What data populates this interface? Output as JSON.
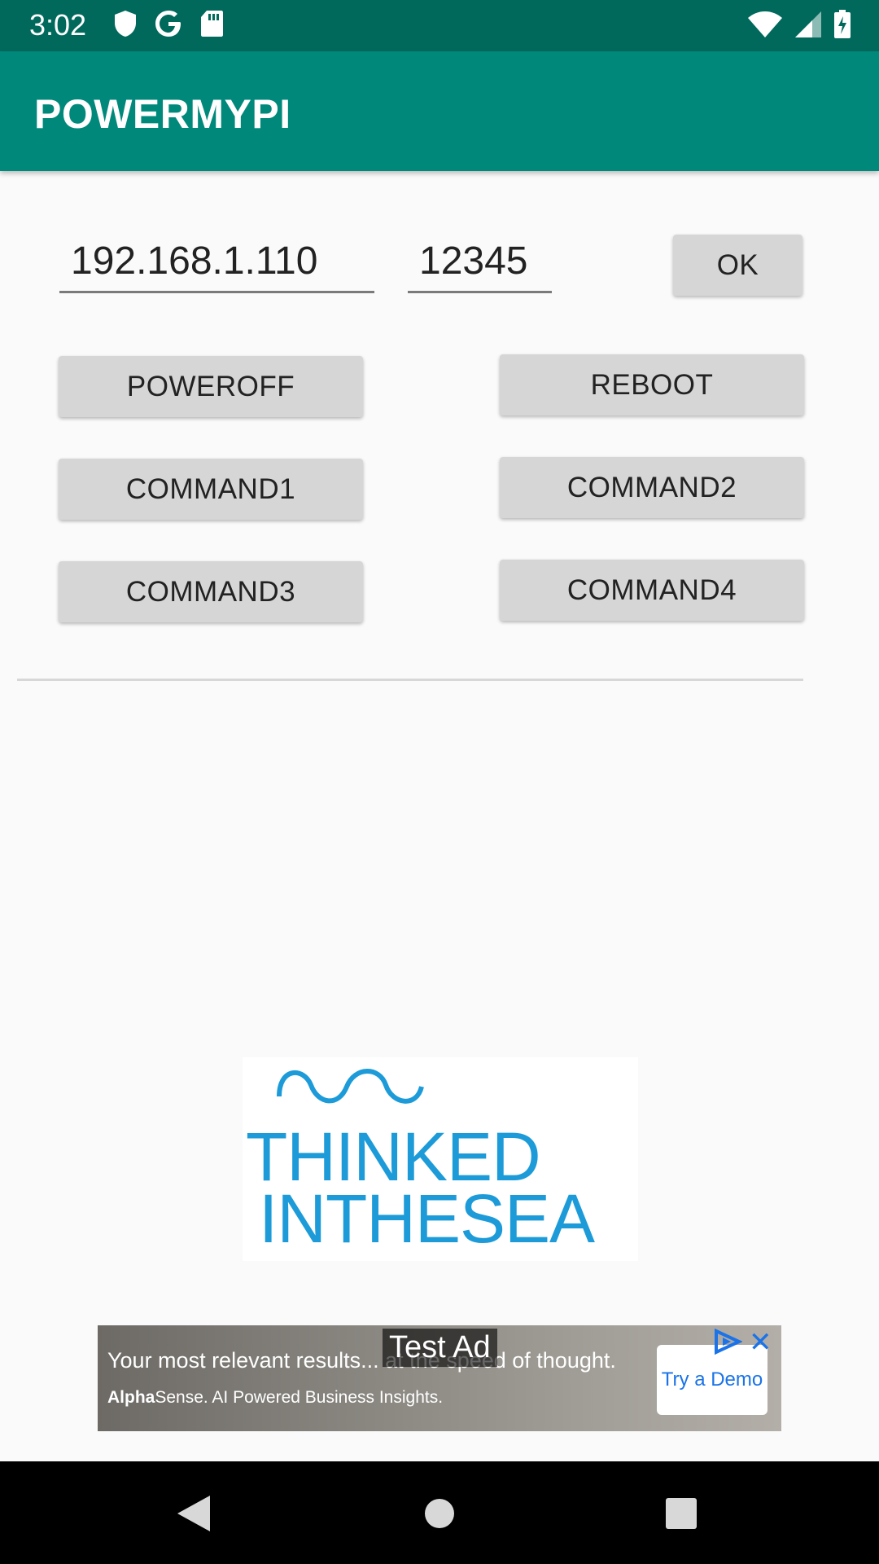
{
  "status_bar": {
    "time": "3:02"
  },
  "app_bar": {
    "title": "POWERMYPI"
  },
  "connection": {
    "ip_value": "192.168.1.110",
    "port_value": "12345",
    "ok_label": "OK"
  },
  "buttons": {
    "poweroff": "POWEROFF",
    "reboot": "REBOOT",
    "command1": "COMMAND1",
    "command2": "COMMAND2",
    "command3": "COMMAND3",
    "command4": "COMMAND4"
  },
  "logo": {
    "line1": "THINKED",
    "line2": "INTHESEA"
  },
  "ad": {
    "label": "Test Ad",
    "headline": "Your most relevant results... at the speed of thought.",
    "brand_bold": "Alpha",
    "brand_rest": "Sense. AI Powered Business Insights.",
    "cta": "Try a Demo",
    "close": "✕"
  },
  "colors": {
    "app_bar": "#00897b",
    "status_bar": "#00695c",
    "logo": "#1d9bd9"
  },
  "icons": [
    "shield-icon",
    "google-icon",
    "sd-card-icon",
    "wifi-icon",
    "signal-icon",
    "battery-icon",
    "back-icon",
    "home-icon",
    "recents-icon",
    "adchoices-icon"
  ]
}
